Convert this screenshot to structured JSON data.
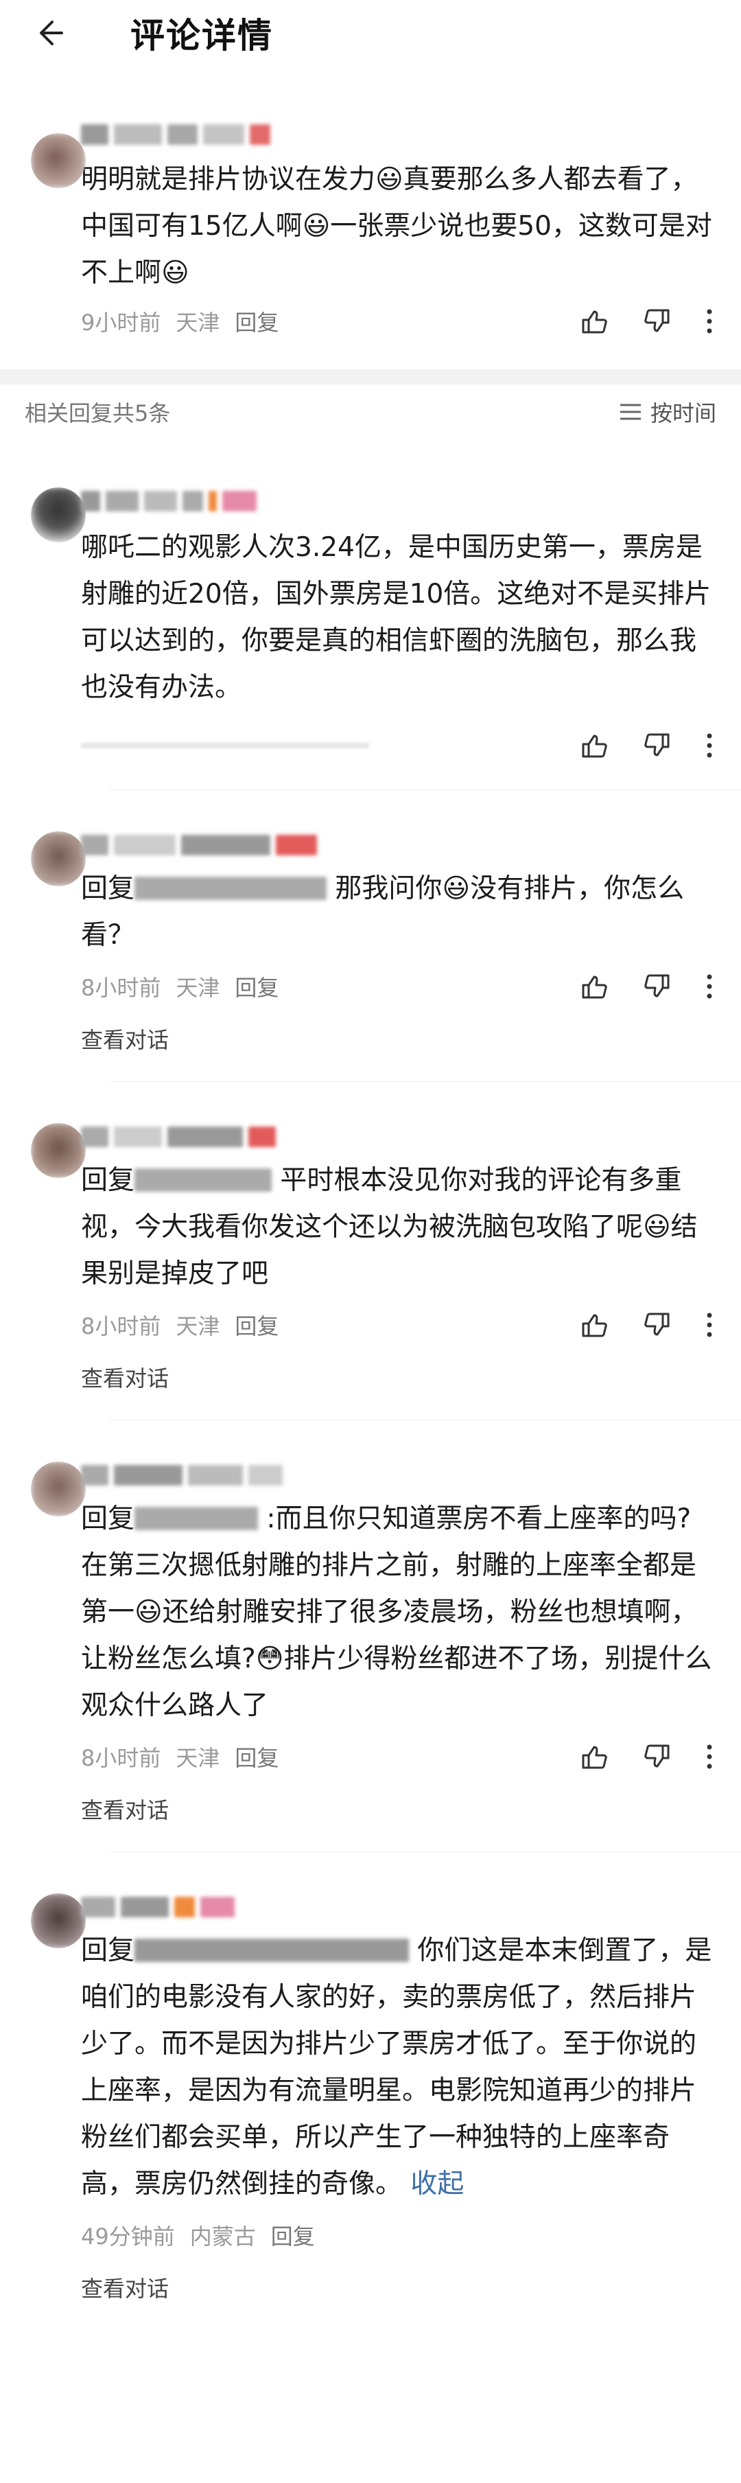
{
  "header": {
    "title": "评论详情"
  },
  "main_comment": {
    "text": "明明就是排片协议在发力😃真要那么多人都去看了，中国可有15亿人啊😃一张票少说也要50，这数可是对不上啊😃",
    "meta_time": "9小时前",
    "meta_loc": "天津",
    "reply_label": "回复"
  },
  "replies_header": {
    "count_label": "相关回复共5条",
    "sort_label": "按时间"
  },
  "replies": [
    {
      "text": "哪吒二的观影人次3.24亿，是中国历史第一，票房是射雕的近20倍，国外票房是10倍。这绝对不是买排片可以达到的，你要是真的相信虾圈的洗脑包，那么我也没有办法。",
      "meta_time": "",
      "meta_loc": "",
      "reply_label": "",
      "see_conv": ""
    },
    {
      "prefix": "回复",
      "text": "那我问你😃没有排片，你怎么看？",
      "meta_time": "8小时前",
      "meta_loc": "天津",
      "reply_label": "回复",
      "see_conv": "查看对话"
    },
    {
      "prefix": "回复",
      "text": "平时根本没见你对我的评论有多重视，今大我看你发这个还以为被洗脑包攻陷了呢😃结果别是掉皮了吧",
      "meta_time": "8小时前",
      "meta_loc": "天津",
      "reply_label": "回复",
      "see_conv": "查看对话"
    },
    {
      "prefix": "回复",
      "text": ":而且你只知道票房不看上座率的吗?在第三次摁低射雕的排片之前，射雕的上座率全都是第一😃还给射雕安排了很多凌晨场，粉丝也想填啊，让粉丝怎么填?😳排片少得粉丝都进不了场，别提什么观众什么路人了",
      "meta_time": "8小时前",
      "meta_loc": "天津",
      "reply_label": "回复",
      "see_conv": "查看对话"
    },
    {
      "prefix": "回复",
      "text": "你们这是本末倒置了，是咱们的电影没有人家的好，卖的票房低了，然后排片少了。而不是因为排片少了票房才低了。至于你说的上座率，是因为有流量明星。电影院知道再少的排片粉丝们都会买单，所以产生了一种独特的上座率奇高，票房仍然倒挂的奇像。",
      "fold_label": "收起",
      "meta_time": "49分钟前",
      "meta_loc": "内蒙古",
      "reply_label": "回复",
      "see_conv": "查看对话"
    }
  ],
  "colors": {
    "accent_link": "#3e6ea8",
    "meta": "#9a9a9a",
    "divider": "#f2f2f2"
  }
}
